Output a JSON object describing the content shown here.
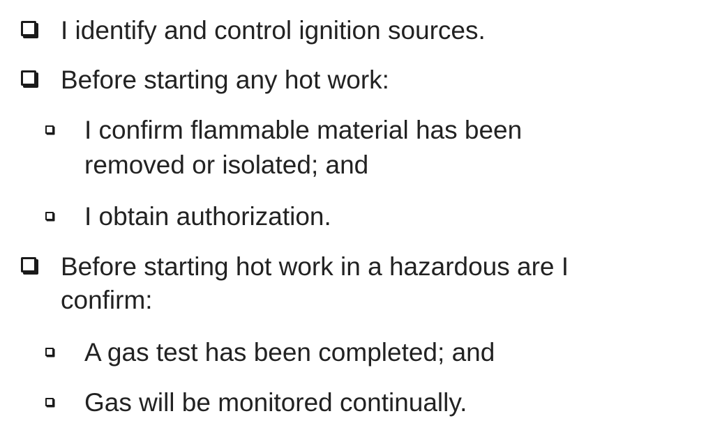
{
  "bullets": [
    {
      "level": 1,
      "text": "I identify and control ignition sources."
    },
    {
      "level": 1,
      "text": "Before starting any hot work:"
    },
    {
      "level": 2,
      "text": "I confirm flammable material has been\nremoved or isolated; and"
    },
    {
      "level": 2,
      "text": "I obtain authorization."
    },
    {
      "level": 1,
      "text": "Before starting hot work in a hazardous are I\nconfirm:"
    },
    {
      "level": 2,
      "text": "A gas test has been completed; and"
    },
    {
      "level": 2,
      "text": "Gas will be monitored continually."
    }
  ],
  "bullet_icon": "checkbox-square-icon",
  "colors": {
    "text": "#222222",
    "background": "#ffffff"
  }
}
